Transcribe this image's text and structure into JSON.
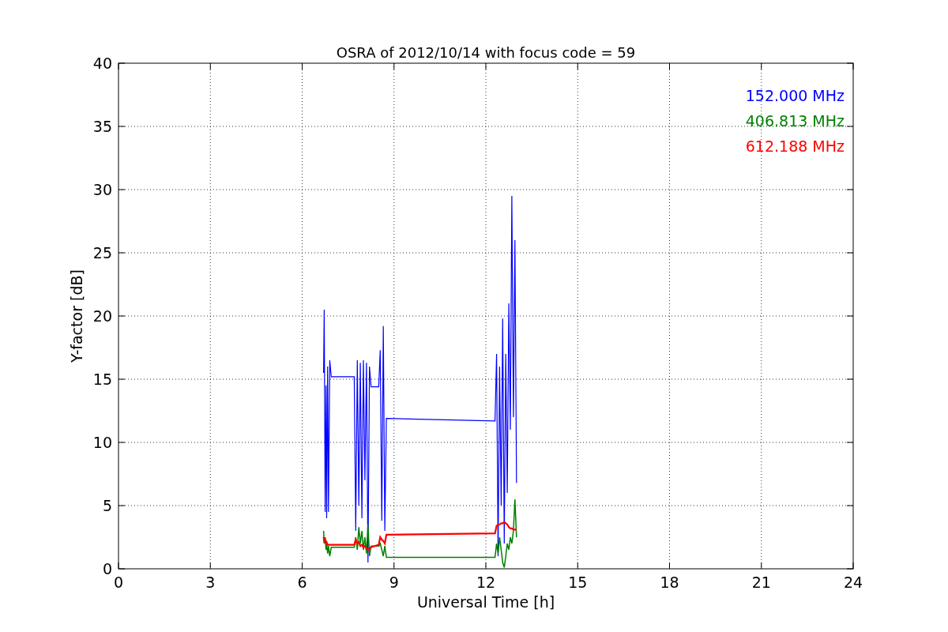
{
  "chart_data": {
    "type": "line",
    "title": "OSRA of 2012/10/14 with focus code = 59",
    "xlabel": "Universal Time [h]",
    "ylabel": "Y-factor [dB]",
    "x": [
      6.7,
      6.72,
      6.75,
      6.78,
      6.8,
      6.83,
      6.86,
      6.9,
      6.95,
      7.7,
      7.75,
      7.8,
      7.85,
      7.9,
      7.95,
      8.0,
      8.05,
      8.1,
      8.15,
      8.2,
      8.25,
      8.5,
      8.55,
      8.6,
      8.65,
      8.7,
      8.75,
      12.3,
      12.35,
      12.4,
      12.45,
      12.5,
      12.55,
      12.6,
      12.65,
      12.7,
      12.75,
      12.8,
      12.85,
      12.9,
      12.95,
      13.0
    ],
    "series": [
      {
        "name": "152.000 MHz",
        "color": "#0000ff",
        "values": [
          15.5,
          20.5,
          4.5,
          14.5,
          4.0,
          16.0,
          4.5,
          16.5,
          15.2,
          15.2,
          3.0,
          16.5,
          5.0,
          16.3,
          4.0,
          16.5,
          7.0,
          16.3,
          0.5,
          16.0,
          14.4,
          14.4,
          17.3,
          3.8,
          19.2,
          3.0,
          11.9,
          11.7,
          17.0,
          1.0,
          16.0,
          5.0,
          19.8,
          2.0,
          17.0,
          6.0,
          21.0,
          11.0,
          29.5,
          12.0,
          26.0,
          6.8
        ]
      },
      {
        "name": "406.813 MHz",
        "color": "#008000",
        "values": [
          3.0,
          2.0,
          2.5,
          1.5,
          2.0,
          1.2,
          1.8,
          1.0,
          1.7,
          1.7,
          2.5,
          1.5,
          3.3,
          2.0,
          3.0,
          1.5,
          2.5,
          1.2,
          3.5,
          1.0,
          1.8,
          1.8,
          2.0,
          1.5,
          1.0,
          1.8,
          0.9,
          0.9,
          2.0,
          1.2,
          2.5,
          1.5,
          0.5,
          0.1,
          1.0,
          2.0,
          1.5,
          2.5,
          2.0,
          3.0,
          5.5,
          2.5
        ]
      },
      {
        "name": "612.188 MHz",
        "color": "#ff0000",
        "values": [
          2.5,
          2.2,
          2.3,
          2.0,
          2.1,
          1.9,
          1.9,
          1.9,
          1.9,
          1.9,
          2.3,
          2.0,
          2.1,
          1.8,
          1.9,
          1.7,
          1.8,
          1.6,
          1.5,
          1.6,
          1.7,
          1.9,
          2.5,
          2.3,
          2.2,
          2.0,
          2.7,
          2.8,
          3.4,
          3.5,
          3.5,
          3.6,
          3.6,
          3.7,
          3.6,
          3.5,
          3.3,
          3.2,
          3.2,
          3.1,
          3.1,
          3.1
        ]
      }
    ],
    "grid": true,
    "xlim": [
      0,
      24
    ],
    "ylim": [
      0,
      40
    ],
    "xticks": [
      0,
      3,
      6,
      9,
      12,
      15,
      18,
      21,
      24
    ],
    "yticks": [
      0,
      5,
      10,
      15,
      20,
      25,
      30,
      35,
      40
    ]
  }
}
